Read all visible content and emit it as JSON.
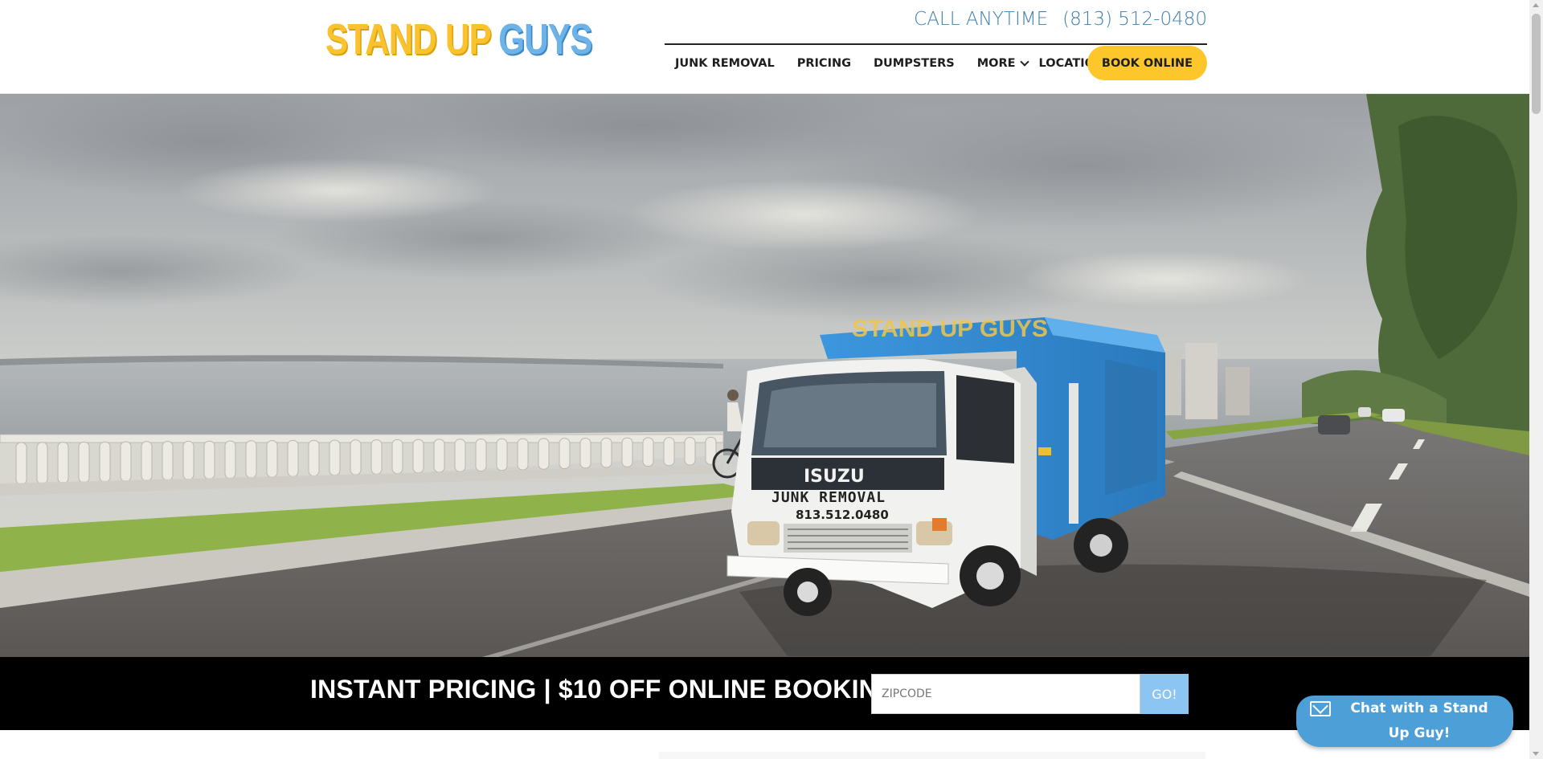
{
  "header": {
    "logo": {
      "word1": "STAND UP",
      "word2": "GUYS"
    },
    "call_label": "CALL ANYTIME",
    "phone": "(813) 512-0480"
  },
  "nav": {
    "items": [
      {
        "label": "JUNK REMOVAL",
        "has_dropdown": false
      },
      {
        "label": "PRICING",
        "has_dropdown": false
      },
      {
        "label": "DUMPSTERS",
        "has_dropdown": false
      },
      {
        "label": "MORE",
        "has_dropdown": true
      },
      {
        "label": "LOCATIONS",
        "has_dropdown": true
      }
    ],
    "book_button": "BOOK ONLINE"
  },
  "hero": {
    "truck": {
      "brand": "ISUZU",
      "side_text": "JUNK REMOVAL",
      "phone": "813.512.0480",
      "box_logo": "STAND UP GUYS"
    }
  },
  "promo": {
    "text": "INSTANT PRICING | $10 OFF ONLINE BOOKING",
    "zip_placeholder": "ZIPCODE",
    "go_label": "GO!"
  },
  "chat": {
    "label": "Chat with a Stand Up Guy!"
  },
  "colors": {
    "logo_yellow": "#f9c22e",
    "logo_blue": "#6db3e8",
    "book_button": "#fdc72c",
    "phone_blue": "#3d7fae",
    "go_button": "#8cc4f2",
    "chat_button": "#4d9fd8"
  }
}
